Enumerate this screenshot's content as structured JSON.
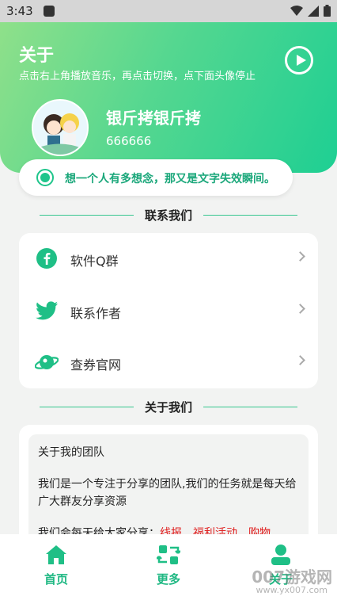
{
  "status_bar": {
    "time": "3:43"
  },
  "header": {
    "title": "关于",
    "subtitle": "点击右上角播放音乐，再点击切换，点下面头像停止",
    "icons": {
      "play": "play-circle-icon"
    }
  },
  "profile": {
    "name": "银斤拷银斤拷",
    "id": "666666"
  },
  "motto": {
    "text": "想一个人有多想念，那又是文字失效瞬间。"
  },
  "contact_section": {
    "title": "联系我们",
    "items": [
      {
        "label": "软件Q群",
        "icon": "facebook-icon"
      },
      {
        "label": "联系作者",
        "icon": "twitter-icon"
      },
      {
        "label": "查券官网",
        "icon": "planet-icon"
      }
    ]
  },
  "about_section": {
    "title": "关于我们",
    "line1": "关于我的团队",
    "line2": "我们是一个专注于分享的团队,我们的任务就是每天给广大群友分享资源",
    "line3_prefix": "我们会每天给大家分享：",
    "line3_highlight": "线报、福利活动、购物"
  },
  "tabbar": {
    "tabs": [
      {
        "label": "首页",
        "icon": "home-icon"
      },
      {
        "label": "更多",
        "icon": "swap-icon"
      },
      {
        "label": "关于",
        "icon": "user-icon"
      }
    ]
  },
  "watermark": {
    "text": "007游戏网",
    "sub": "www.yx007.com"
  },
  "colors": {
    "accent": "#1fc58b",
    "header_start": "#8fe08a",
    "header_end": "#1ecf93",
    "highlight": "#e02020"
  }
}
